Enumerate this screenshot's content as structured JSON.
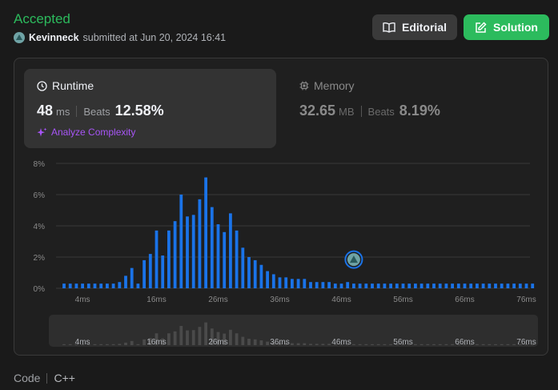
{
  "header": {
    "status": "Accepted",
    "username": "Kevinneck",
    "submitted_text": "submitted at Jun 20, 2024 16:41"
  },
  "buttons": {
    "editorial": "Editorial",
    "solution": "Solution"
  },
  "runtime": {
    "title": "Runtime",
    "value": "48",
    "unit": "ms",
    "beats_label": "Beats",
    "beats": "12.58%",
    "analyze": "Analyze Complexity"
  },
  "memory": {
    "title": "Memory",
    "value": "32.65",
    "unit": "MB",
    "beats_label": "Beats",
    "beats": "8.19%"
  },
  "footer": {
    "code_label": "Code",
    "language": "C++"
  },
  "colors": {
    "accent_green": "#2cbb5d",
    "bar_blue": "#1a73e8",
    "purple": "#a855f7"
  },
  "chart_data": {
    "type": "bar",
    "x_start_ms": 1,
    "x_step_ms": 1,
    "values": [
      0.3,
      0.3,
      0.3,
      0.3,
      0.3,
      0.3,
      0.3,
      0.3,
      0.3,
      0.4,
      0.8,
      1.3,
      0.3,
      1.8,
      2.2,
      3.7,
      2.1,
      3.7,
      4.3,
      6.0,
      4.6,
      4.7,
      5.7,
      7.1,
      5.2,
      4.1,
      3.6,
      4.8,
      3.7,
      2.6,
      2.0,
      1.8,
      1.5,
      1.1,
      0.9,
      0.7,
      0.7,
      0.6,
      0.6,
      0.6,
      0.4,
      0.4,
      0.4,
      0.4,
      0.3,
      0.3,
      0.4,
      0.3,
      0.3,
      0.3,
      0.3,
      0.3,
      0.3,
      0.3,
      0.3,
      0.3,
      0.3,
      0.3,
      0.3,
      0.3,
      0.3,
      0.3,
      0.3,
      0.3,
      0.3,
      0.3,
      0.3,
      0.3,
      0.3,
      0.3,
      0.3,
      0.3,
      0.3,
      0.3,
      0.3,
      0.3,
      0.3
    ],
    "yticks": [
      "0%",
      "2%",
      "4%",
      "6%",
      "8%"
    ],
    "ylim": [
      0,
      8
    ],
    "xtick_labels": [
      "4ms",
      "16ms",
      "26ms",
      "36ms",
      "46ms",
      "56ms",
      "66ms",
      "76ms"
    ],
    "marker_value_ms": 48,
    "grid": true
  }
}
